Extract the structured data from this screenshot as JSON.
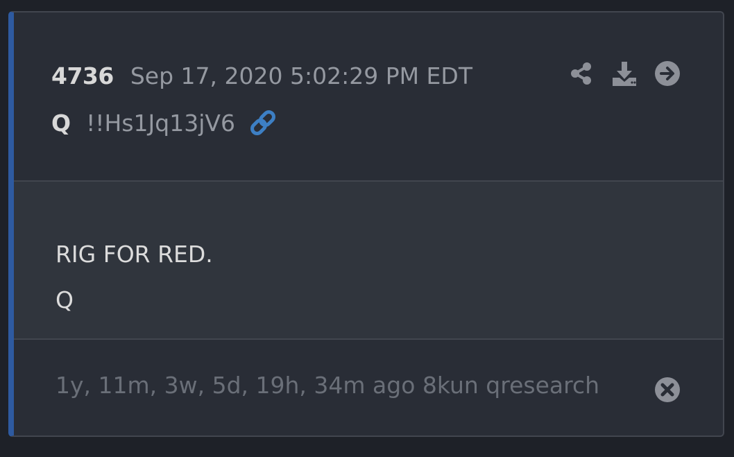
{
  "post": {
    "number": "4736",
    "timestamp": "Sep 17, 2020 5:02:29 PM EDT",
    "author": "Q",
    "tripcode": "!!Hs1Jq13jV6",
    "body_lines": [
      "RIG FOR RED.",
      "Q"
    ],
    "footer_age": "1y, 11m, 3w, 5d, 19h, 34m ago",
    "footer_source": "8kun qresearch"
  },
  "icons": {
    "link": "link-icon",
    "share": "share-icon",
    "download": "download-icon",
    "goto": "arrow-right-circle-icon",
    "close": "close-circle-icon"
  },
  "colors": {
    "accent_bar": "#2e5aa0",
    "link_icon": "#3d7fc4",
    "action_icons": "#8d9098"
  }
}
